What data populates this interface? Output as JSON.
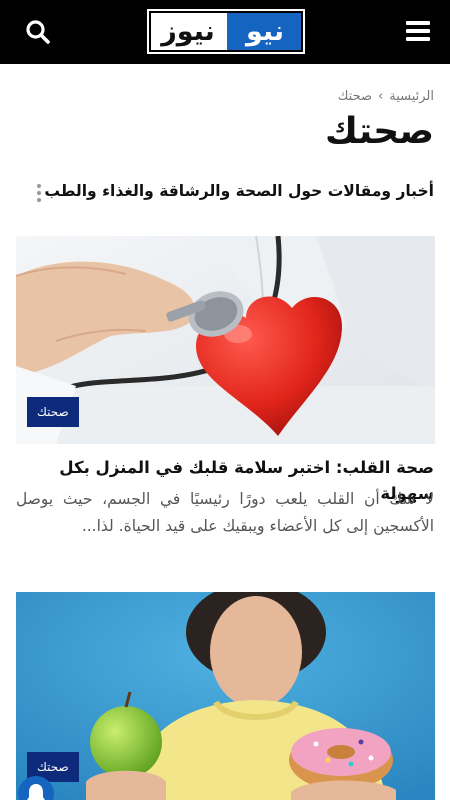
{
  "header": {
    "logo_primary": "نيو",
    "logo_secondary": "نيوز",
    "menu_icon": "hamburger-menu-icon",
    "search_icon": "search-icon",
    "background": "#000000",
    "accent": "#1565c0"
  },
  "breadcrumb": {
    "home": "الرئيسية",
    "separator": "›",
    "current": "صحتك"
  },
  "page": {
    "title": "صحتك",
    "description": "أخبار ومقالات حول الصحة والرشاقة والغذاء والطب"
  },
  "articles": [
    {
      "category": "صحتك",
      "title": "صحة القلب: اختبر سلامة قلبك في المنزل بكل سهولة",
      "excerpt": "لا شك أن القلب يلعب دورًا رئيسيًا في الجسم، حيث يوصل الأكسجين إلى كل الأعضاء ويبقيك على قيد الحياة. لذا...",
      "image": "heart-stethoscope-photo"
    },
    {
      "category": "صحتك",
      "image": "apple-donut-choice-photo"
    }
  ],
  "colors": {
    "badge": "#0d2b7a",
    "text": "#111111",
    "muted": "#555555"
  },
  "notification_icon": "bell-icon"
}
